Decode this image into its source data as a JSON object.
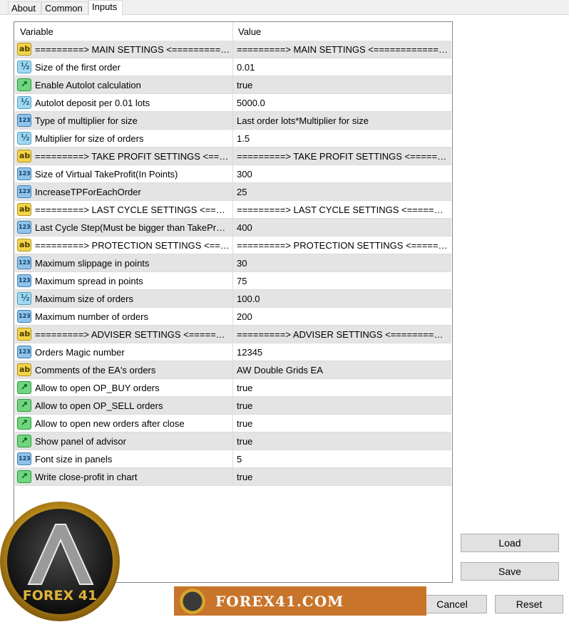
{
  "tabs": [
    {
      "label": "About"
    },
    {
      "label": "Common"
    },
    {
      "label": "Inputs"
    }
  ],
  "grid": {
    "columns": {
      "variable": "Variable",
      "value": "Value"
    },
    "rows": [
      {
        "icon": "ab",
        "name": "=========> MAIN SETTINGS  <================================",
        "value": "=========> MAIN SETTINGS  <================================"
      },
      {
        "icon": "half",
        "name": "Size of the first order",
        "value": "0.01"
      },
      {
        "icon": "bool",
        "name": "Enable Autolot  calculation",
        "value": "true"
      },
      {
        "icon": "half",
        "name": "Autolot deposit per 0.01 lots",
        "value": "5000.0"
      },
      {
        "icon": "123",
        "name": "Type of multiplier for size",
        "value": "Last order lots*Multiplier for size"
      },
      {
        "icon": "half",
        "name": "Multiplier for size of orders",
        "value": "1.5"
      },
      {
        "icon": "ab",
        "name": "=========> TAKE PROFIT SETTINGS  <==========================",
        "value": "=========> TAKE PROFIT SETTINGS  <==========================="
      },
      {
        "icon": "123",
        "name": "Size of Virtual TakeProfit(In Points)",
        "value": "300"
      },
      {
        "icon": "123",
        "name": "IncreaseTPForEachOrder",
        "value": "25"
      },
      {
        "icon": "ab",
        "name": "=========> LAST CYCLE SETTINGS  <===========================",
        "value": "=========> LAST CYCLE SETTINGS  <============================"
      },
      {
        "icon": "123",
        "name": "Last Cycle Step(Must be bigger than TakeProfit)",
        "value": "400"
      },
      {
        "icon": "ab",
        "name": "=========> PROTECTION SETTINGS  <===========================",
        "value": "=========> PROTECTION SETTINGS  <============================"
      },
      {
        "icon": "123",
        "name": "Maximum slippage in points",
        "value": "30"
      },
      {
        "icon": "123",
        "name": "Maximum spread in points",
        "value": "75"
      },
      {
        "icon": "half",
        "name": "Maximum size of orders",
        "value": "100.0"
      },
      {
        "icon": "123",
        "name": "Maximum number of orders",
        "value": "200"
      },
      {
        "icon": "ab",
        "name": "=========> ADVISER SETTINGS  <==============================",
        "value": "=========> ADVISER SETTINGS  <==============================="
      },
      {
        "icon": "123",
        "name": "Orders Magic number",
        "value": "12345"
      },
      {
        "icon": "ab",
        "name": "Comments of the EA's orders",
        "value": "AW Double Grids EA"
      },
      {
        "icon": "bool",
        "name": "Allow to open OP_BUY orders",
        "value": "true"
      },
      {
        "icon": "bool",
        "name": "Allow to open OP_SELL orders",
        "value": "true"
      },
      {
        "icon": "bool",
        "name": "Allow to open new orders after close",
        "value": "true"
      },
      {
        "icon": "bool",
        "name": "Show panel of advisor",
        "value": "true"
      },
      {
        "icon": "123",
        "name": "Font size in panels",
        "value": "5"
      },
      {
        "icon": "bool",
        "name": "Write close-profit in chart",
        "value": "true"
      }
    ]
  },
  "buttons": {
    "load": "Load",
    "save": "Save",
    "cancel": "Cancel",
    "reset": "Reset"
  },
  "watermark": {
    "logo_text": "FOREX 41",
    "banner_text": "FOREX41.COM"
  }
}
